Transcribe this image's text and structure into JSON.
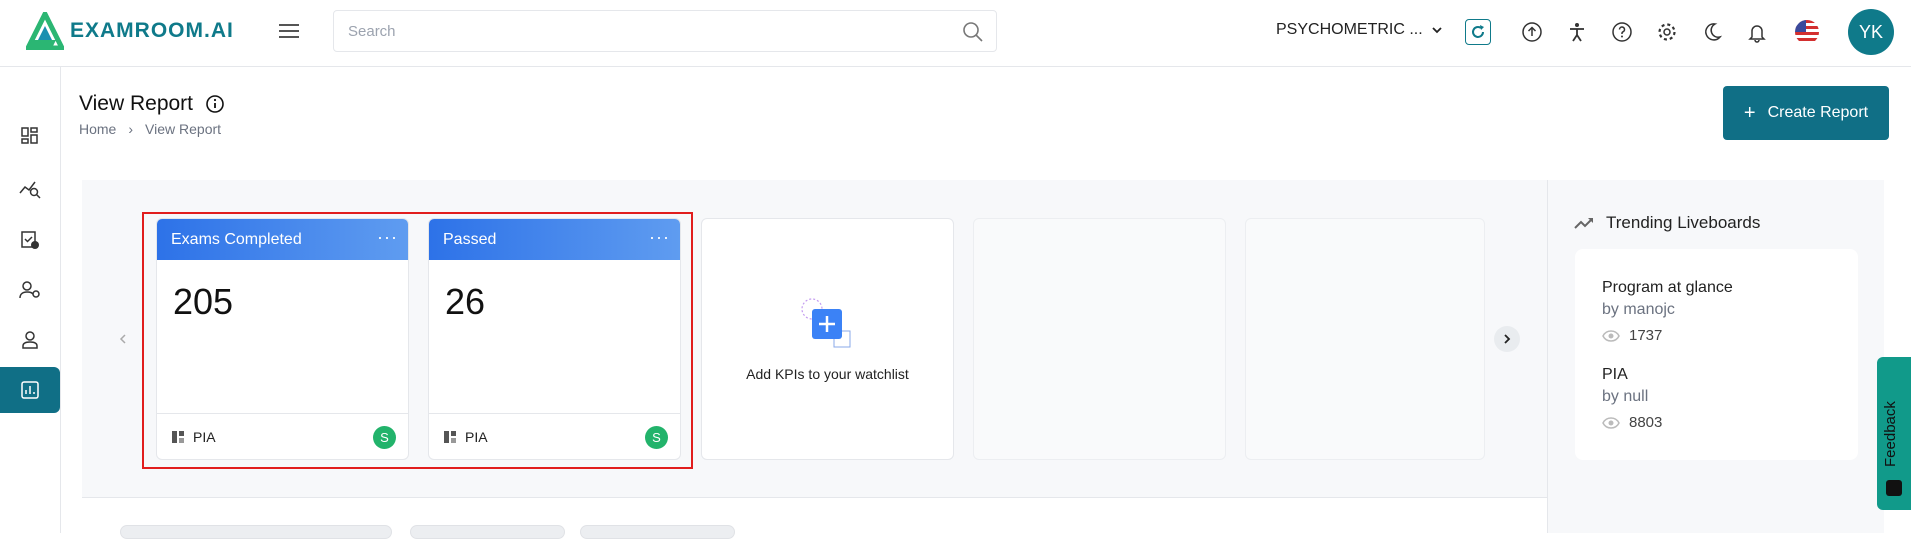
{
  "header": {
    "logo_text": "EXAMROOM.AI",
    "search_placeholder": "Search",
    "program_selector": "PSYCHOMETRIC ...",
    "avatar_initials": "YK",
    "colors": {
      "brand": "#106f86",
      "logo_green": "#2bb673"
    }
  },
  "page": {
    "title": "View Report",
    "breadcrumb": [
      "Home",
      "View Report"
    ],
    "create_button": "Create Report"
  },
  "kpis": [
    {
      "title": "Exams Completed",
      "value": "205",
      "source": "PIA",
      "badge": "S"
    },
    {
      "title": "Passed",
      "value": "26",
      "source": "PIA",
      "badge": "S"
    }
  ],
  "add_card": {
    "text": "Add KPIs to your watchlist"
  },
  "trending": {
    "title": "Trending Liveboards",
    "items": [
      {
        "name": "Program at glance",
        "by": "by manojc",
        "views": "1737"
      },
      {
        "name": "PIA",
        "by": "by null",
        "views": "8803"
      }
    ]
  },
  "feedback": {
    "label": "Feedback"
  },
  "sidebar": {
    "items": [
      "dashboard-icon",
      "analytics-search-icon",
      "exam-schedule-icon",
      "user-settings-icon",
      "candidate-icon",
      "reports-icon"
    ],
    "active_index": 5
  }
}
